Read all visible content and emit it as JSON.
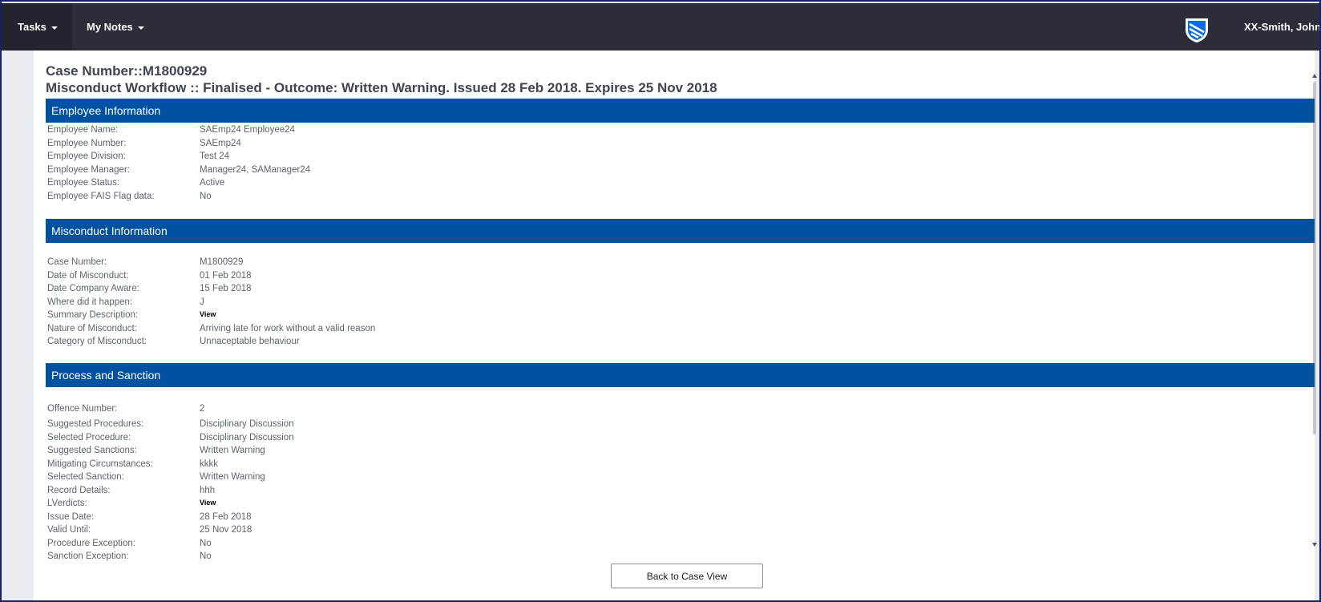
{
  "nav": {
    "tasks_label": "Tasks",
    "notes_label": "My Notes",
    "user_name": "XX-Smith, John"
  },
  "header": {
    "case_title": "Case Number::M1800929",
    "workflow_title": "Misconduct Workflow :: Finalised - Outcome: Written Warning. Issued 28 Feb 2018. Expires 25 Nov 2018"
  },
  "employee": {
    "heading": "Employee Information",
    "rows": [
      {
        "label": "Employee Name:",
        "value": "SAEmp24 Employee24"
      },
      {
        "label": "Employee Number:",
        "value": "SAEmp24"
      },
      {
        "label": "Employee Division:",
        "value": "Test 24"
      },
      {
        "label": "Employee Manager:",
        "value": "Manager24, SAManager24"
      },
      {
        "label": "Employee Status:",
        "value": "Active"
      },
      {
        "label": "Employee FAIS Flag data:",
        "value": "No"
      }
    ]
  },
  "misconduct": {
    "heading": "Misconduct Information",
    "rows": [
      {
        "label": "Case Number:",
        "value": "M1800929"
      },
      {
        "label": "Date of Misconduct:",
        "value": "01 Feb 2018"
      },
      {
        "label": "Date Company Aware:",
        "value": "15 Feb 2018"
      },
      {
        "label": "Where did it happen:",
        "value": "J"
      },
      {
        "label": "Summary Description:",
        "value": "View"
      },
      {
        "label": "Nature of Misconduct:",
        "value": "Arriving late for work without a valid reason"
      },
      {
        "label": "Category of Misconduct:",
        "value": "Unnaceptable behaviour"
      }
    ]
  },
  "process": {
    "heading": "Process and Sanction",
    "rows": [
      {
        "label": "Offence Number:",
        "value": "2"
      },
      {
        "label": "Suggested Procedures:",
        "value": "Disciplinary Discussion"
      },
      {
        "label": "Selected Procedure:",
        "value": "Disciplinary Discussion"
      },
      {
        "label": "Suggested Sanctions:",
        "value": "Written Warning"
      },
      {
        "label": "Mitigating Circumstances:",
        "value": "kkkk"
      },
      {
        "label": "Selected Sanction:",
        "value": "Written Warning"
      },
      {
        "label": "Record Details:",
        "value": "hhh"
      },
      {
        "label": "LVerdicts:",
        "value": "View"
      },
      {
        "label": "Issue Date:",
        "value": "28 Feb 2018"
      },
      {
        "label": "Valid Until:",
        "value": "25 Nov 2018"
      },
      {
        "label": "Procedure Exception:",
        "value": "No"
      },
      {
        "label": "Sanction Exception:",
        "value": "No"
      }
    ]
  },
  "footer": {
    "back_label": "Back to Case View"
  },
  "colors": {
    "topbar": "#2b2d38",
    "section_header": "#0052a0"
  }
}
